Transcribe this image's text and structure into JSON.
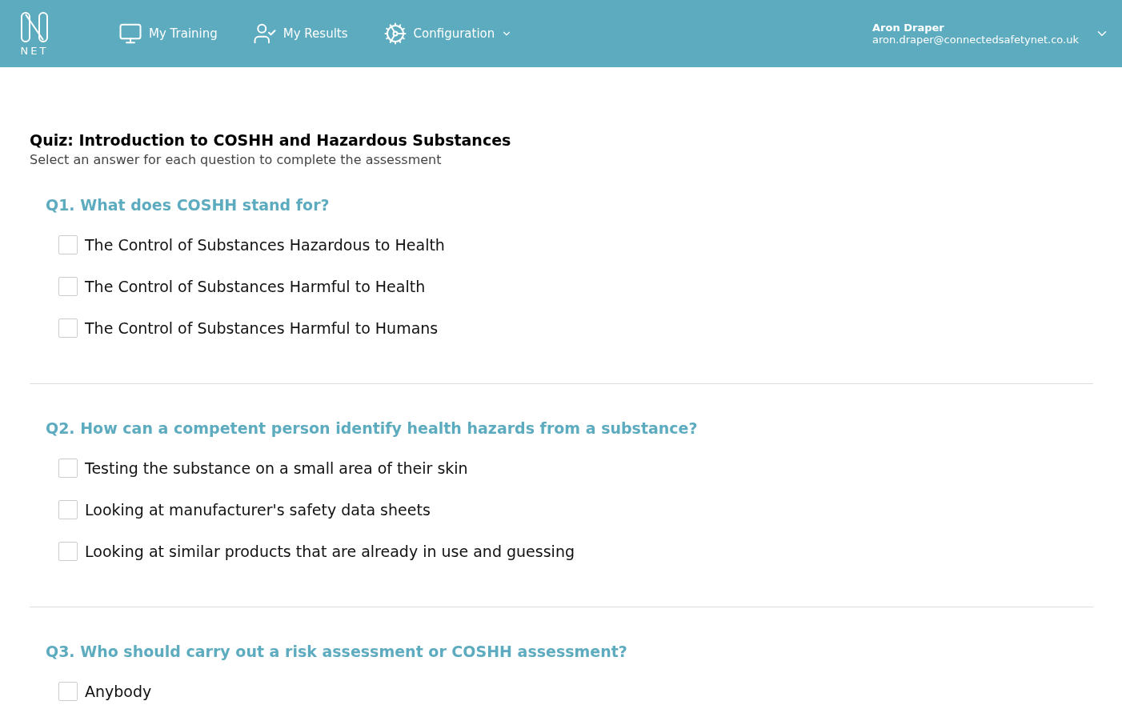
{
  "header": {
    "logo_text": "NET",
    "nav": [
      {
        "label": "My Training",
        "kind": "training",
        "dropdown": false
      },
      {
        "label": "My Results",
        "kind": "results",
        "dropdown": false
      },
      {
        "label": "Configuration",
        "kind": "config",
        "dropdown": true
      }
    ],
    "user": {
      "name": "Aron Draper",
      "email": "aron.draper@connectedsafetynet.co.uk"
    }
  },
  "quiz": {
    "title": "Quiz: Introduction to COSHH and Hazardous Substances",
    "subtitle": "Select an answer for each question to complete the assessment",
    "questions": [
      {
        "text": "Q1. What does COSHH stand for?",
        "options": [
          {
            "label": "The Control of Substances Hazardous to Health",
            "checked": false
          },
          {
            "label": "The Control of Substances Harmful to Health",
            "checked": false
          },
          {
            "label": "The Control of Substances Harmful to Humans",
            "checked": false
          }
        ]
      },
      {
        "text": "Q2. How can a competent person identify health hazards from a substance?",
        "options": [
          {
            "label": "Testing the substance on a small area of their skin",
            "checked": false
          },
          {
            "label": "Looking at manufacturer's safety data sheets",
            "checked": false
          },
          {
            "label": "Looking at similar products that are already in use and guessing",
            "checked": false
          }
        ]
      },
      {
        "text": "Q3. Who should carry out a risk assessment or COSHH assessment?",
        "options": [
          {
            "label": "Anybody",
            "checked": false
          }
        ]
      }
    ]
  }
}
